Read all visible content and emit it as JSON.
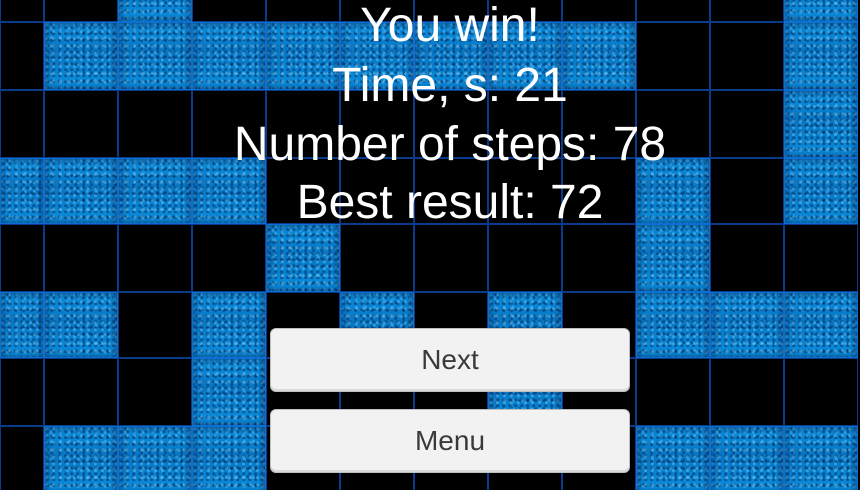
{
  "result": {
    "title": "You win!",
    "time_text": "Time, s: 21",
    "steps_text": "Number of steps: 78",
    "best_text": "Best result: 72"
  },
  "buttons": {
    "next_label": "Next",
    "menu_label": "Menu"
  },
  "board": {
    "rows": 7,
    "cols": 12,
    "grid": [
      [
        0,
        0,
        1,
        0,
        0,
        0,
        0,
        0,
        0,
        0,
        0,
        1
      ],
      [
        0,
        1,
        1,
        1,
        1,
        1,
        1,
        1,
        1,
        0,
        0,
        1
      ],
      [
        0,
        0,
        0,
        0,
        0,
        0,
        0,
        0,
        0,
        0,
        0,
        1
      ],
      [
        1,
        1,
        1,
        1,
        0,
        0,
        0,
        0,
        0,
        1,
        0,
        1
      ],
      [
        0,
        0,
        0,
        0,
        1,
        0,
        0,
        0,
        0,
        1,
        0,
        0
      ],
      [
        1,
        1,
        0,
        1,
        0,
        1,
        0,
        1,
        0,
        1,
        1,
        1
      ],
      [
        0,
        0,
        0,
        1,
        0,
        0,
        0,
        1,
        0,
        0,
        0,
        0
      ]
    ],
    "bottom_row": [
      0,
      1,
      1,
      1,
      0,
      0,
      0,
      0,
      0,
      1,
      1,
      1
    ]
  },
  "colors": {
    "block": "#0a8fe0",
    "grid_line": "#0a3a8c",
    "background": "#000000",
    "button_bg": "#f2f2f2",
    "text": "#ffffff"
  }
}
